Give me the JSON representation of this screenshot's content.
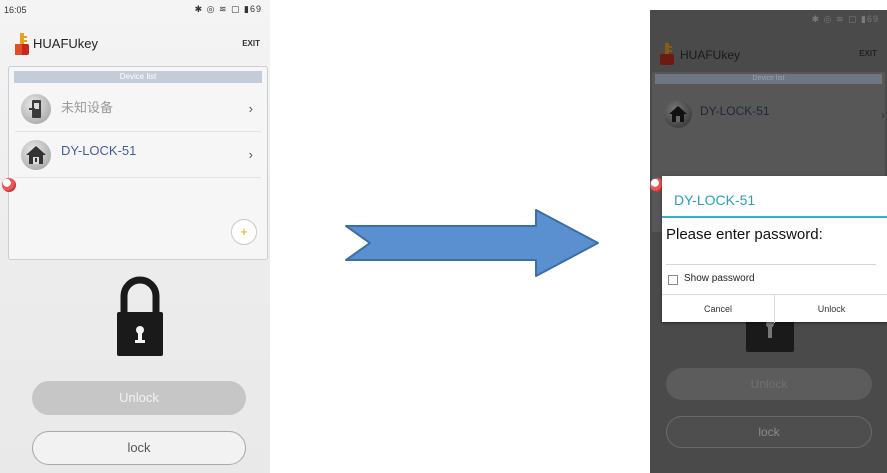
{
  "left_screen": {
    "status_bar": {
      "time": "16:05",
      "icons": "✱ ◎ ≋ ▢ ▮69"
    },
    "header": {
      "app_title": "HUAFUkey",
      "exit_label": "EXIT"
    },
    "device_list": {
      "header": "Device list",
      "items": [
        {
          "name": "未知设备",
          "name_color": "#9a9a9a",
          "icon": "door-lock-icon"
        },
        {
          "name": "DY-LOCK-51",
          "name_color": "#4a5aa0",
          "icon": "house-icon"
        }
      ],
      "add_symbol": "+"
    },
    "buttons": {
      "unlock": "Unlock",
      "lock": "lock"
    }
  },
  "arrow": {
    "color": "#5a8fd0",
    "icon": "right-arrow-icon"
  },
  "right_screen": {
    "status_bar": {
      "icons": "✱ ◎ ≋ ▢ ▮69"
    },
    "header": {
      "app_title": "HUAFUkey",
      "exit_label": "EXIT"
    },
    "device_list": {
      "header": "Device list",
      "items": [
        {
          "name": "DY-LOCK-51",
          "icon": "house-icon"
        }
      ]
    },
    "dialog": {
      "title": "DY-LOCK-51",
      "prompt": "Please enter password:",
      "password_value": "",
      "show_password_label": "Show password",
      "show_password_checked": false,
      "cancel_label": "Cancel",
      "unlock_label": "Unlock"
    },
    "buttons": {
      "unlock": "Unlock",
      "lock": "lock"
    }
  }
}
